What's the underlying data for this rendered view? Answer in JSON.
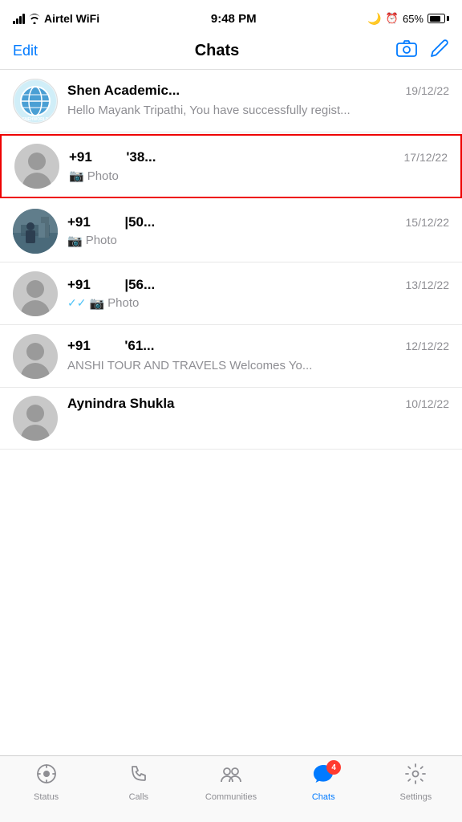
{
  "statusBar": {
    "carrier": "Airtel WiFi",
    "time": "9:48 PM",
    "battery": "65%"
  },
  "navBar": {
    "editLabel": "Edit",
    "title": "Chats"
  },
  "chats": [
    {
      "id": 1,
      "name": "Shen Academic...",
      "time": "19/12/22",
      "preview": "Hello Mayank Tripathi, You have successfully regist...",
      "hasCamera": false,
      "hasDoubleCheck": false,
      "avatarType": "logo",
      "highlighted": false
    },
    {
      "id": 2,
      "name": "+91          '38...",
      "time": "17/12/22",
      "preview": "Photo",
      "hasCamera": true,
      "hasDoubleCheck": false,
      "avatarType": "person",
      "highlighted": true
    },
    {
      "id": 3,
      "name": "+91          |50...",
      "time": "15/12/22",
      "preview": "Photo",
      "hasCamera": true,
      "hasDoubleCheck": false,
      "avatarType": "person-photo",
      "highlighted": false
    },
    {
      "id": 4,
      "name": "+91          |56...",
      "time": "13/12/22",
      "preview": "Photo",
      "hasCamera": true,
      "hasDoubleCheck": true,
      "avatarType": "person",
      "highlighted": false
    },
    {
      "id": 5,
      "name": "+91          '61...",
      "time": "12/12/22",
      "preview": "ANSHI TOUR AND TRAVELS Welcomes Yo...",
      "hasCamera": false,
      "hasDoubleCheck": false,
      "avatarType": "person",
      "highlighted": false
    }
  ],
  "partialChat": {
    "name": "Aynindra Shukla",
    "time": "10/12/22"
  },
  "tabBar": {
    "items": [
      {
        "id": "status",
        "label": "Status",
        "icon": "status"
      },
      {
        "id": "calls",
        "label": "Calls",
        "icon": "calls"
      },
      {
        "id": "communities",
        "label": "Communities",
        "icon": "communities"
      },
      {
        "id": "chats",
        "label": "Chats",
        "icon": "chats",
        "active": true,
        "badge": 4
      },
      {
        "id": "settings",
        "label": "Settings",
        "icon": "settings"
      }
    ]
  }
}
